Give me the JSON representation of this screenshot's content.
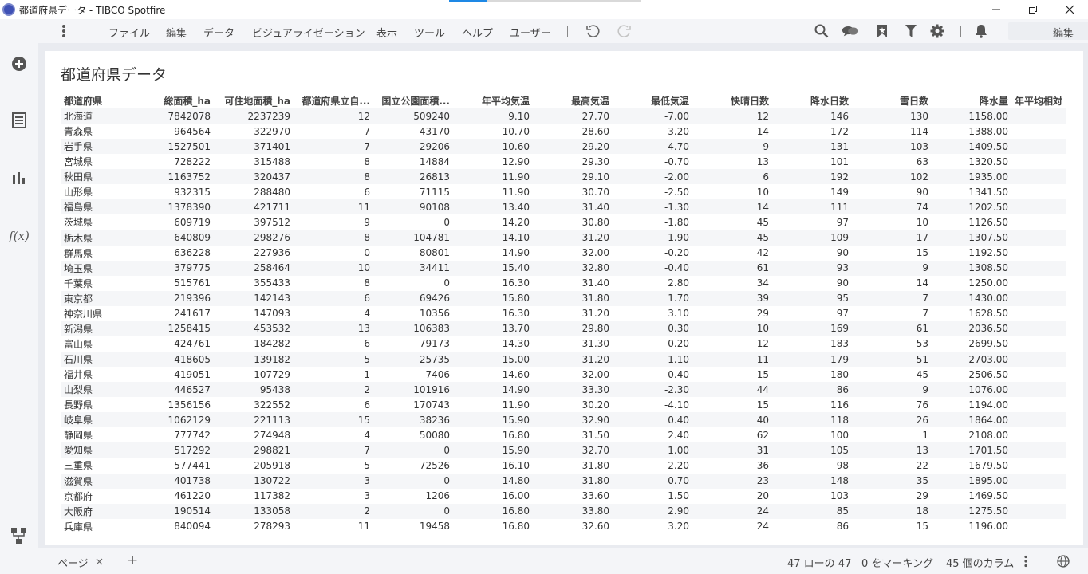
{
  "window": {
    "title": "都道府県データ - TIBCO Spotfire"
  },
  "menu": {
    "items": [
      "ファイル",
      "編集",
      "データ",
      "ビジュアライゼーション",
      "表示",
      "ツール",
      "ヘルプ",
      "ユーザー"
    ],
    "mode_label": "編集"
  },
  "icons": {
    "sidebar": [
      "add-icon",
      "data-table-icon",
      "bar-chart-icon",
      "function-icon",
      "hierarchy-icon"
    ],
    "function_label": "f(x)",
    "toolbar": [
      "undo-icon",
      "redo-icon",
      "search-icon",
      "chat-icon",
      "bookmark-icon",
      "filter-icon",
      "gear-icon",
      "bell-icon"
    ]
  },
  "visualization": {
    "title": "都道府県データ",
    "columns": [
      "都道府県",
      "総面積_ha",
      "可住地面積_ha",
      "都道府県立自...",
      "国立公園面積...",
      "年平均気温",
      "最高気温",
      "最低気温",
      "快晴日数",
      "降水日数",
      "雪日数",
      "降水量",
      "年平均相対"
    ],
    "rows": [
      [
        "北海道",
        "7842078",
        "2237239",
        "12",
        "509240",
        "9.10",
        "27.70",
        "-7.00",
        "12",
        "146",
        "130",
        "1158.00",
        ""
      ],
      [
        "青森県",
        "964564",
        "322970",
        "7",
        "43170",
        "10.70",
        "28.60",
        "-3.20",
        "14",
        "172",
        "114",
        "1388.00",
        ""
      ],
      [
        "岩手県",
        "1527501",
        "371401",
        "7",
        "29206",
        "10.60",
        "29.20",
        "-4.70",
        "9",
        "131",
        "103",
        "1409.50",
        ""
      ],
      [
        "宮城県",
        "728222",
        "315488",
        "8",
        "14884",
        "12.90",
        "29.30",
        "-0.70",
        "13",
        "101",
        "63",
        "1320.50",
        ""
      ],
      [
        "秋田県",
        "1163752",
        "320437",
        "8",
        "26813",
        "11.90",
        "29.10",
        "-2.00",
        "6",
        "192",
        "102",
        "1935.00",
        ""
      ],
      [
        "山形県",
        "932315",
        "288480",
        "6",
        "71115",
        "11.90",
        "30.70",
        "-2.50",
        "10",
        "149",
        "90",
        "1341.50",
        ""
      ],
      [
        "福島県",
        "1378390",
        "421711",
        "11",
        "90108",
        "13.40",
        "31.40",
        "-1.30",
        "14",
        "111",
        "74",
        "1202.50",
        ""
      ],
      [
        "茨城県",
        "609719",
        "397512",
        "9",
        "0",
        "14.20",
        "30.80",
        "-1.80",
        "45",
        "97",
        "10",
        "1126.50",
        ""
      ],
      [
        "栃木県",
        "640809",
        "298276",
        "8",
        "104781",
        "14.10",
        "31.20",
        "-1.90",
        "45",
        "109",
        "17",
        "1307.50",
        ""
      ],
      [
        "群馬県",
        "636228",
        "227936",
        "0",
        "80801",
        "14.90",
        "32.00",
        "-0.20",
        "42",
        "90",
        "15",
        "1192.50",
        ""
      ],
      [
        "埼玉県",
        "379775",
        "258464",
        "10",
        "34411",
        "15.40",
        "32.80",
        "-0.40",
        "61",
        "93",
        "9",
        "1308.50",
        ""
      ],
      [
        "千葉県",
        "515761",
        "355433",
        "8",
        "0",
        "16.30",
        "31.40",
        "2.80",
        "34",
        "90",
        "14",
        "1250.00",
        ""
      ],
      [
        "東京都",
        "219396",
        "142143",
        "6",
        "69426",
        "15.80",
        "31.80",
        "1.70",
        "39",
        "95",
        "7",
        "1430.00",
        ""
      ],
      [
        "神奈川県",
        "241617",
        "147093",
        "4",
        "10356",
        "16.30",
        "31.20",
        "3.10",
        "29",
        "97",
        "7",
        "1628.50",
        ""
      ],
      [
        "新潟県",
        "1258415",
        "453532",
        "13",
        "106383",
        "13.70",
        "29.80",
        "0.30",
        "10",
        "169",
        "61",
        "2036.50",
        ""
      ],
      [
        "富山県",
        "424761",
        "184282",
        "6",
        "79173",
        "14.30",
        "31.30",
        "0.20",
        "12",
        "183",
        "53",
        "2699.50",
        ""
      ],
      [
        "石川県",
        "418605",
        "139182",
        "5",
        "25735",
        "15.00",
        "31.20",
        "1.10",
        "11",
        "179",
        "51",
        "2703.00",
        ""
      ],
      [
        "福井県",
        "419051",
        "107729",
        "1",
        "7406",
        "14.60",
        "32.00",
        "0.40",
        "15",
        "180",
        "45",
        "2506.50",
        ""
      ],
      [
        "山梨県",
        "446527",
        "95438",
        "2",
        "101916",
        "14.90",
        "33.30",
        "-2.30",
        "44",
        "86",
        "9",
        "1076.00",
        ""
      ],
      [
        "長野県",
        "1356156",
        "322552",
        "6",
        "170743",
        "11.90",
        "30.20",
        "-4.10",
        "15",
        "116",
        "76",
        "1194.00",
        ""
      ],
      [
        "岐阜県",
        "1062129",
        "221113",
        "15",
        "38236",
        "15.90",
        "32.90",
        "0.40",
        "40",
        "118",
        "26",
        "1864.00",
        ""
      ],
      [
        "静岡県",
        "777742",
        "274948",
        "4",
        "50080",
        "16.80",
        "31.50",
        "2.40",
        "62",
        "100",
        "1",
        "2108.00",
        ""
      ],
      [
        "愛知県",
        "517292",
        "298821",
        "7",
        "0",
        "15.90",
        "32.70",
        "1.00",
        "31",
        "105",
        "13",
        "1701.50",
        ""
      ],
      [
        "三重県",
        "577441",
        "205918",
        "5",
        "72526",
        "16.10",
        "31.80",
        "2.20",
        "36",
        "98",
        "22",
        "1679.50",
        ""
      ],
      [
        "滋賀県",
        "401738",
        "130722",
        "3",
        "0",
        "14.80",
        "31.80",
        "0.70",
        "23",
        "148",
        "35",
        "1895.00",
        ""
      ],
      [
        "京都府",
        "461220",
        "117382",
        "3",
        "1206",
        "16.00",
        "33.60",
        "1.50",
        "20",
        "103",
        "29",
        "1469.50",
        ""
      ],
      [
        "大阪府",
        "190514",
        "133058",
        "2",
        "0",
        "16.80",
        "33.80",
        "2.90",
        "24",
        "85",
        "18",
        "1275.50",
        ""
      ],
      [
        "兵庫県",
        "840094",
        "278293",
        "11",
        "19458",
        "16.80",
        "32.60",
        "3.20",
        "24",
        "86",
        "15",
        "1196.00",
        ""
      ]
    ]
  },
  "status": {
    "page_tab": "ページ",
    "add_page": "+",
    "rows": "47 ローの 47",
    "marked": "0 をマーキング",
    "columns": "45 個のカラム"
  }
}
